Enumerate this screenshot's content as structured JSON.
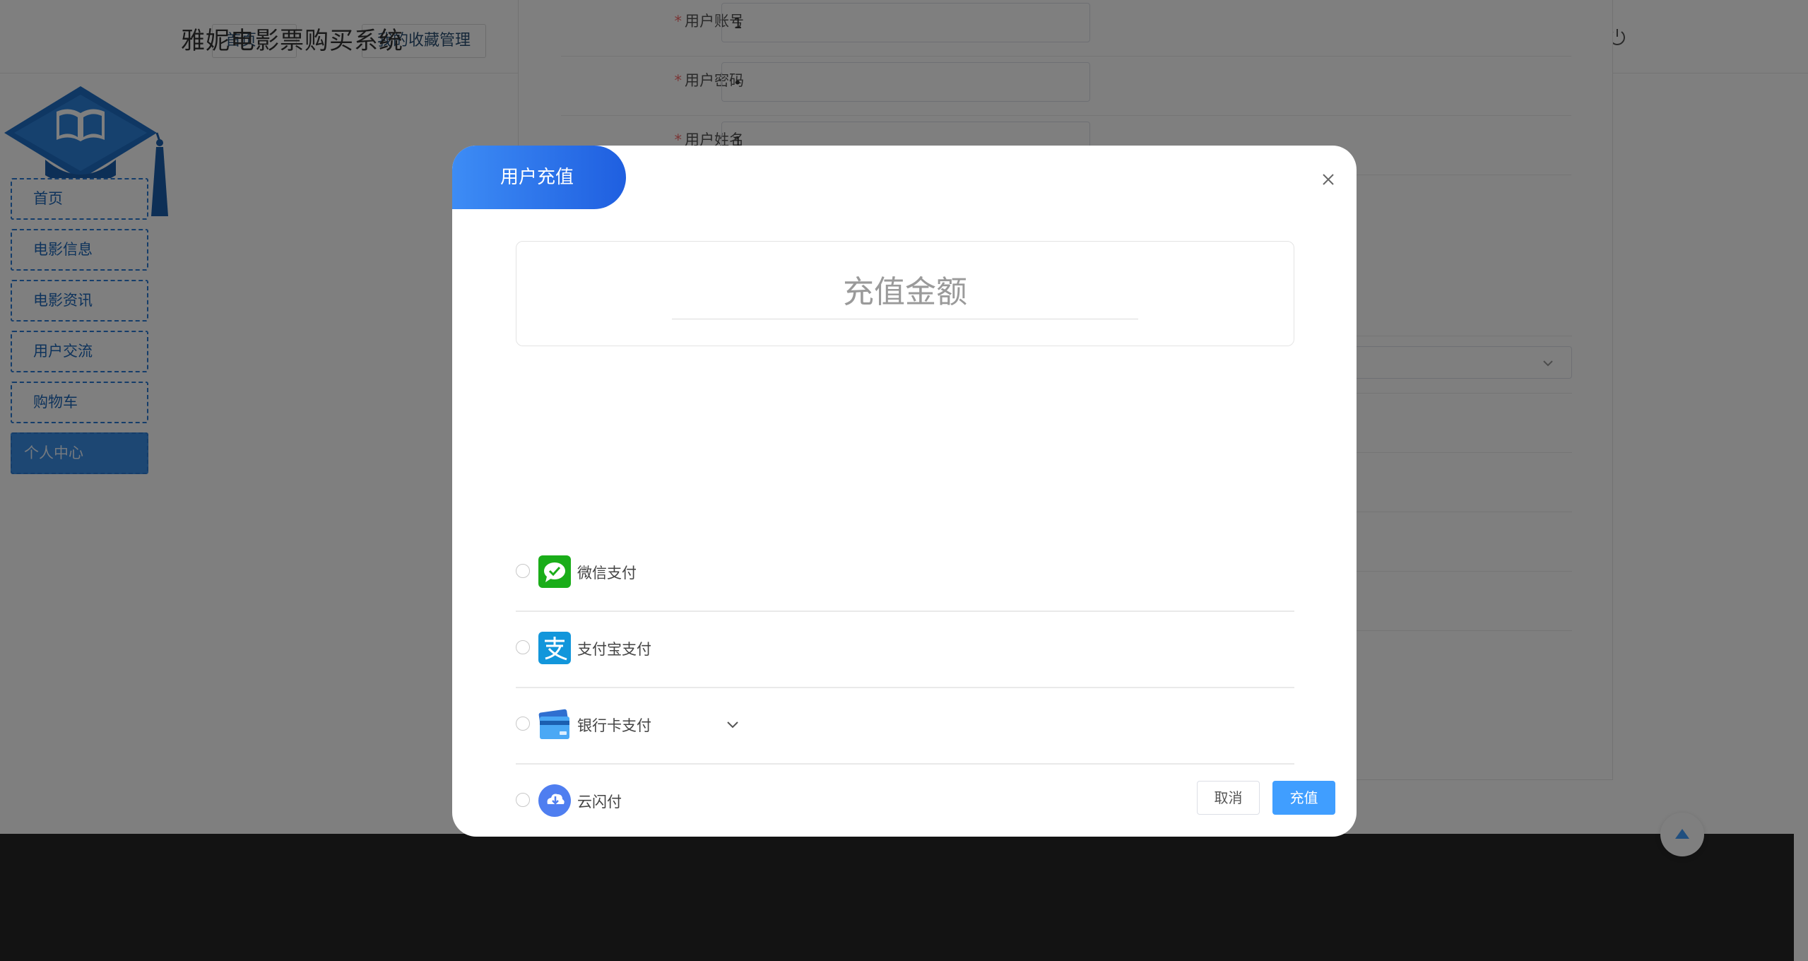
{
  "header": {
    "site_title": "雅妮电影票购买系统",
    "tabs": [
      {
        "label": "首页"
      },
      {
        "label": "我的收藏管理"
      }
    ]
  },
  "sidebar": {
    "items": [
      {
        "label": "首页"
      },
      {
        "label": "电影信息"
      },
      {
        "label": "电影资讯"
      },
      {
        "label": "用户交流"
      },
      {
        "label": "购物车"
      },
      {
        "label": "个人中心"
      }
    ],
    "active_index": 5
  },
  "profile_form": {
    "fields": [
      {
        "label": "用户账号",
        "value": "1",
        "required": true
      },
      {
        "label": "用户密码",
        "value": "•",
        "required": true
      },
      {
        "label": "用户姓名",
        "value": "1",
        "required": true
      }
    ]
  },
  "dialog": {
    "title": "用户充值",
    "amount_placeholder": "充值金额",
    "payment_methods": [
      {
        "label": "微信支付",
        "icon": "wechat-pay-icon",
        "color": "#1aad19"
      },
      {
        "label": "支付宝支付",
        "icon": "alipay-icon",
        "color": "#1296db"
      },
      {
        "label": "银行卡支付",
        "icon": "bank-card-icon",
        "color": "#4a9ff5"
      },
      {
        "label": "云闪付",
        "icon": "unionpay-cloud-icon",
        "color": "#4f7ef0"
      }
    ],
    "cancel_label": "取消",
    "confirm_label": "充值"
  },
  "colors": {
    "accent": "#409eff",
    "title_gradient_start": "#3d8cf5",
    "title_gradient_end": "#1f5fe0",
    "nav_border": "#2a7bd4",
    "footer": "#262626"
  }
}
